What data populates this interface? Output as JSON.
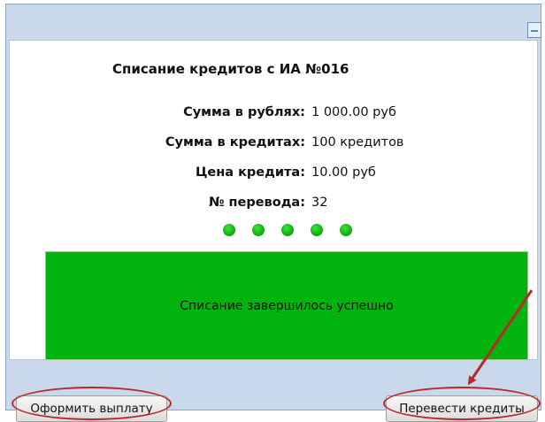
{
  "dialog": {
    "title": "Списание кредитов с ИА №016",
    "fields": [
      {
        "label": "Сумма в рублях:",
        "value": "1 000.00 руб"
      },
      {
        "label": "Сумма в кредитах:",
        "value": "100 кредитов"
      },
      {
        "label": "Цена кредита:",
        "value": "10.00 руб"
      },
      {
        "label": "№ перевода:",
        "value": "32"
      }
    ],
    "progress": {
      "dots_count": 5,
      "dot_color": "#14b414"
    },
    "status_message": "Списание завершилось успешно",
    "status_color": "#00b40d"
  },
  "buttons": {
    "left_label": "Оформить выплату",
    "right_label": "Перевести кредиты"
  },
  "annotations": {
    "highlight_color": "#b52a2a"
  }
}
